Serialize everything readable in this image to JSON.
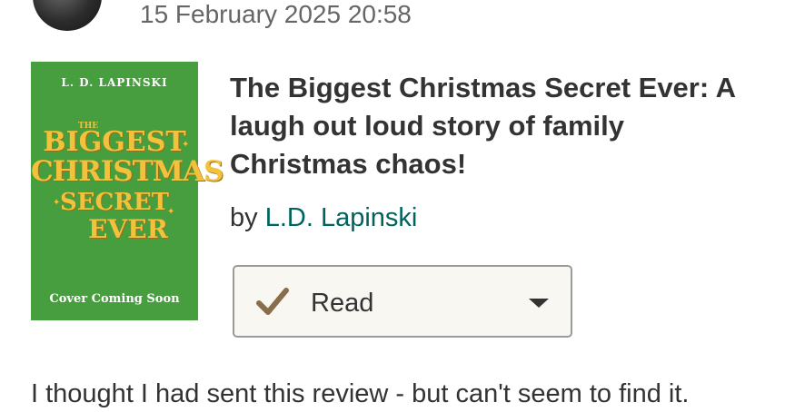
{
  "review": {
    "timestamp": "15 February 2025 20:58",
    "text": "I thought I had sent this review - but can't seem to find it."
  },
  "book": {
    "title": "The Biggest Christmas Secret Ever: A laugh out loud story of family Christmas chaos!",
    "by_prefix": "by",
    "author": "L.D. Lapinski",
    "cover": {
      "author": "L. D. LAPINSKI",
      "title_small": "THE",
      "title_lines": [
        "BIGGEST",
        "CHRISTMAS",
        "SECRET",
        "EVER"
      ],
      "footer": "Cover Coming Soon",
      "background": "#479e3e",
      "title_color": "#f3c23c"
    }
  },
  "shelf": {
    "label": "Read",
    "icon": "check-icon",
    "dropdown_icon": "caret-down-icon",
    "check_color": "#8a6d4b"
  },
  "colors": {
    "link": "#00635d",
    "text": "#333333"
  }
}
